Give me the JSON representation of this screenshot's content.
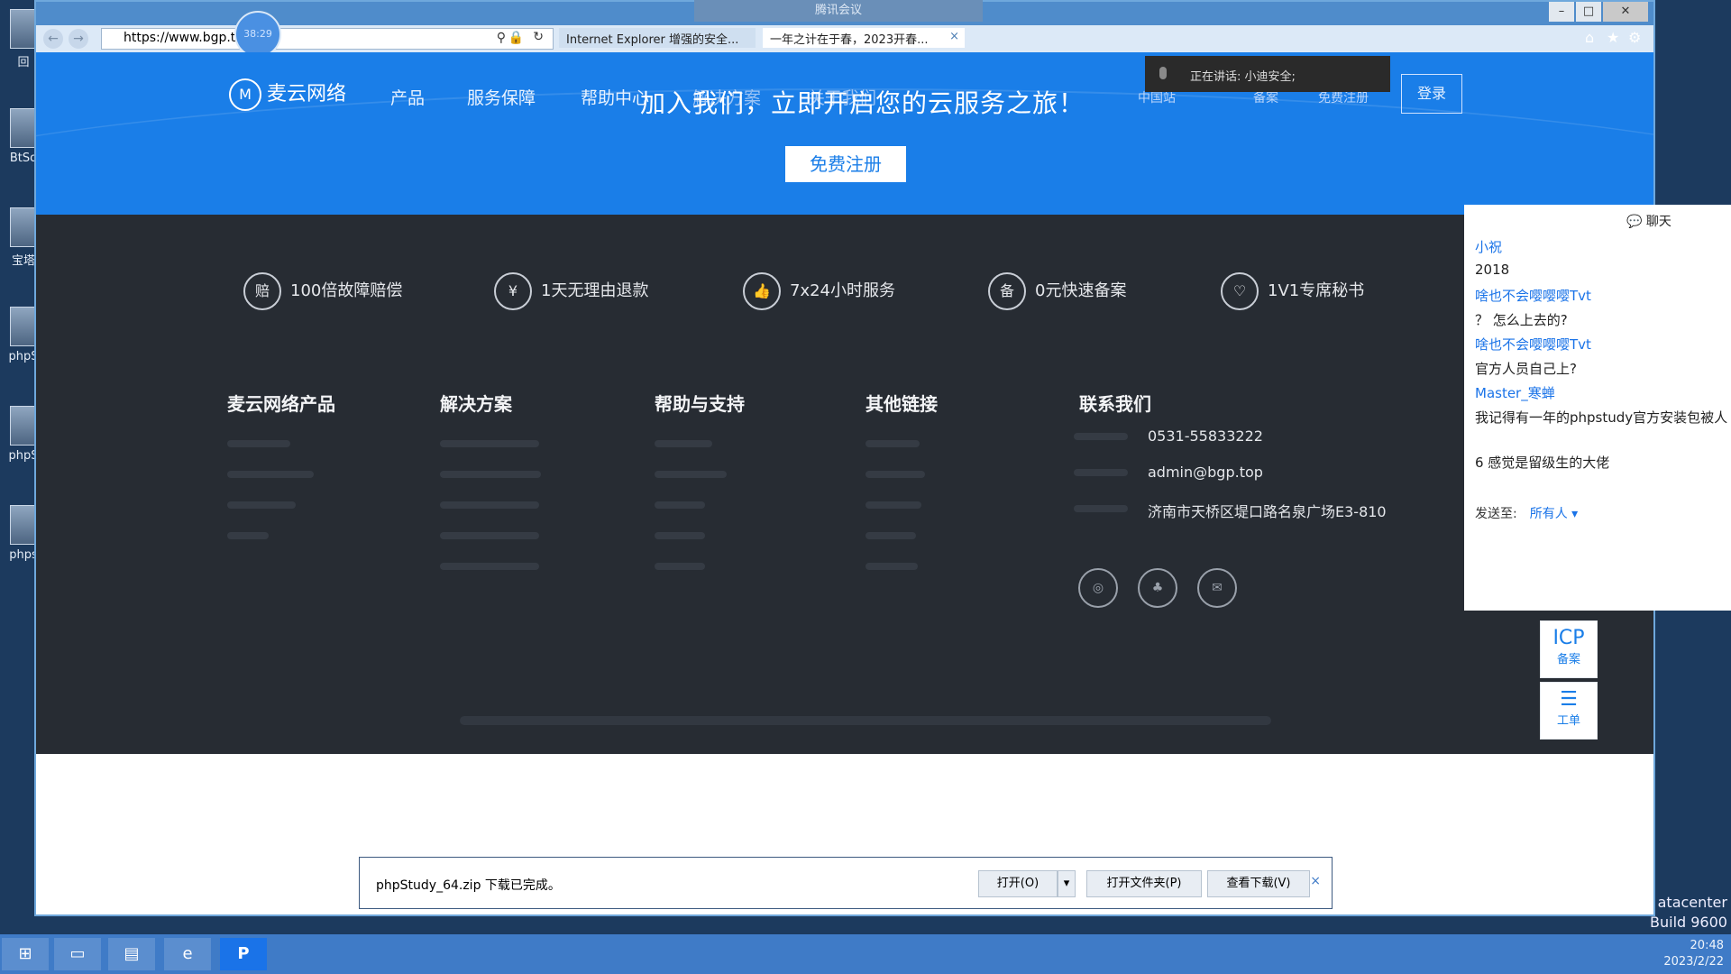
{
  "desktop": {
    "icons": [
      "回",
      "BtSo",
      "宝塔",
      "phpS",
      "phpS",
      "phps"
    ]
  },
  "meeting": {
    "label": "腾讯会议"
  },
  "browser": {
    "url": "https://www.bgp.to",
    "timer": "38:29",
    "tabs": [
      "Internet Explorer 增强的安全...",
      "一年之计在于春，2023开春..."
    ],
    "tab_close": "×"
  },
  "site": {
    "logo": "麦云网络",
    "nav": [
      "产品",
      "服务保障",
      "帮助中心",
      "解决方案",
      "关于我们"
    ],
    "hero_title": "加入我们，立即开启您的云服务之旅！",
    "register_label": "免费注册",
    "login_label": "登录",
    "right_nav": [
      "中国站",
      "备案",
      "免费注册"
    ],
    "speaking": "正在讲话: 小迪安全;",
    "features": [
      {
        "icon": "赔",
        "label": "100倍故障赔偿"
      },
      {
        "icon": "¥",
        "label": "1天无理由退款"
      },
      {
        "icon": "👍",
        "label": "7x24小时服务"
      },
      {
        "icon": "备",
        "label": "0元快速备案"
      },
      {
        "icon": "♡",
        "label": "1V1专席秘书"
      }
    ],
    "footer_cols": [
      "麦云网络产品",
      "解决方案",
      "帮助与支持",
      "其他链接",
      "联系我们"
    ],
    "contact": {
      "phone": "0531-55833222",
      "email": "admin@bgp.top",
      "address": "济南市天桥区堤口路名泉广场E3-810"
    },
    "side_tools": [
      {
        "icon": "ICP",
        "label": "备案"
      },
      {
        "icon": "☰",
        "label": "工单"
      }
    ]
  },
  "download_bar": {
    "message": "phpStudy_64.zip 下载已完成。",
    "open": "打开(O)",
    "open_folder": "打开文件夹(P)",
    "view_downloads": "查看下载(V)",
    "close": "×"
  },
  "chat": {
    "title": "聊天",
    "messages": [
      {
        "type": "name",
        "text": "小祝"
      },
      {
        "type": "text",
        "text": "2018"
      },
      {
        "type": "name",
        "text": "啥也不会嘤嘤嘤Tvt"
      },
      {
        "type": "text",
        "text": "？ 怎么上去的?"
      },
      {
        "type": "name",
        "text": "啥也不会嘤嘤嘤Tvt"
      },
      {
        "type": "text",
        "text": "官方人员自己上?"
      },
      {
        "type": "name",
        "text": "Master_寒蝉"
      },
      {
        "type": "text",
        "text": "我记得有一年的phpstudy官方安装包被人"
      },
      {
        "type": "text",
        "text": "6 感觉是留级生的大佬"
      }
    ],
    "send_to_label": "发送至:",
    "send_to_value": "所有人"
  },
  "os": {
    "build_line1": "atacenter",
    "build_line2": "Build 9600",
    "time": "20:48",
    "date": "2023/2/22"
  }
}
